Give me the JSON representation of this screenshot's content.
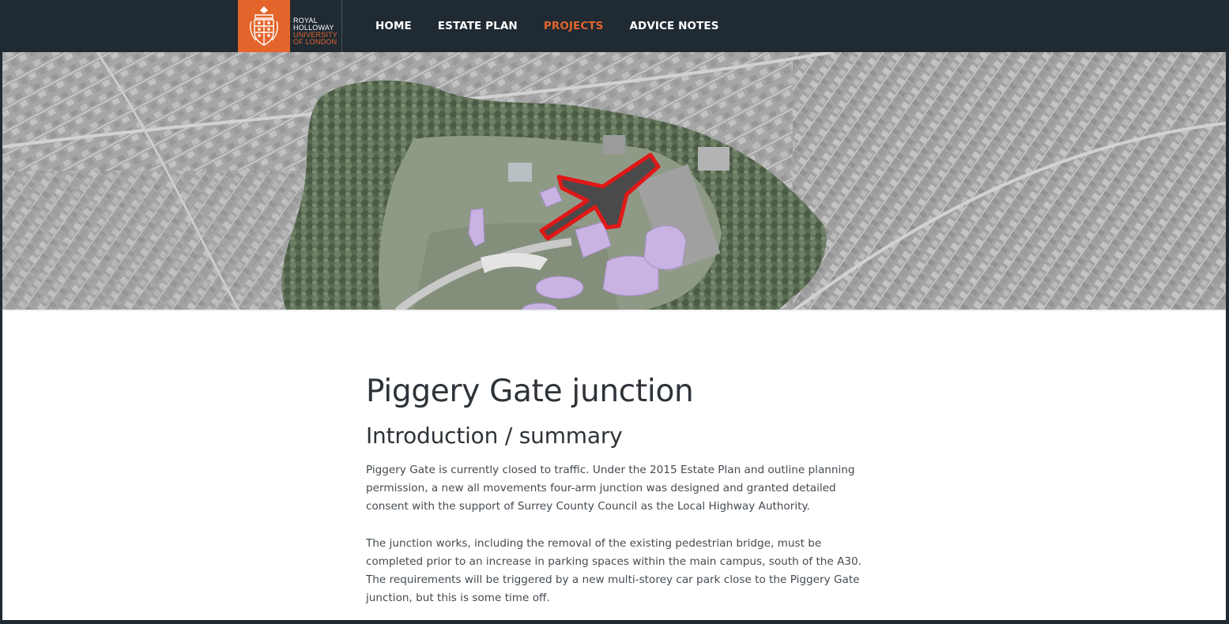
{
  "logo": {
    "line1": "ROYAL",
    "line2": "HOLLOWAY",
    "line3": "UNIVERSITY",
    "line4": "OF LONDON",
    "brand_color": "#e4652b",
    "crest_icon": "crest-icon"
  },
  "nav": {
    "items": [
      {
        "label": "HOME",
        "active": false
      },
      {
        "label": "ESTATE PLAN",
        "active": false
      },
      {
        "label": "PROJECTS",
        "active": true
      },
      {
        "label": "ADVICE NOTES",
        "active": false
      }
    ],
    "active_color": "#e4652b"
  },
  "hero": {
    "highlight_color": "#e01818",
    "building_color": "#c9b3e3"
  },
  "article": {
    "title": "Piggery Gate junction",
    "section_heading": "Introduction / summary",
    "paragraphs": [
      "Piggery Gate is currently closed to traffic. Under the 2015 Estate Plan and outline planning permission, a new all movements four-arm junction was designed and granted detailed consent with the support of Surrey County Council as the Local Highway Authority.",
      "The junction works, including the removal of the existing pedestrian bridge, must be completed prior to an  increase in parking spaces within the main campus, south of the A30. The requirements will be triggered by a new multi-storey car park close to the Piggery Gate junction, but this is some time off."
    ]
  }
}
